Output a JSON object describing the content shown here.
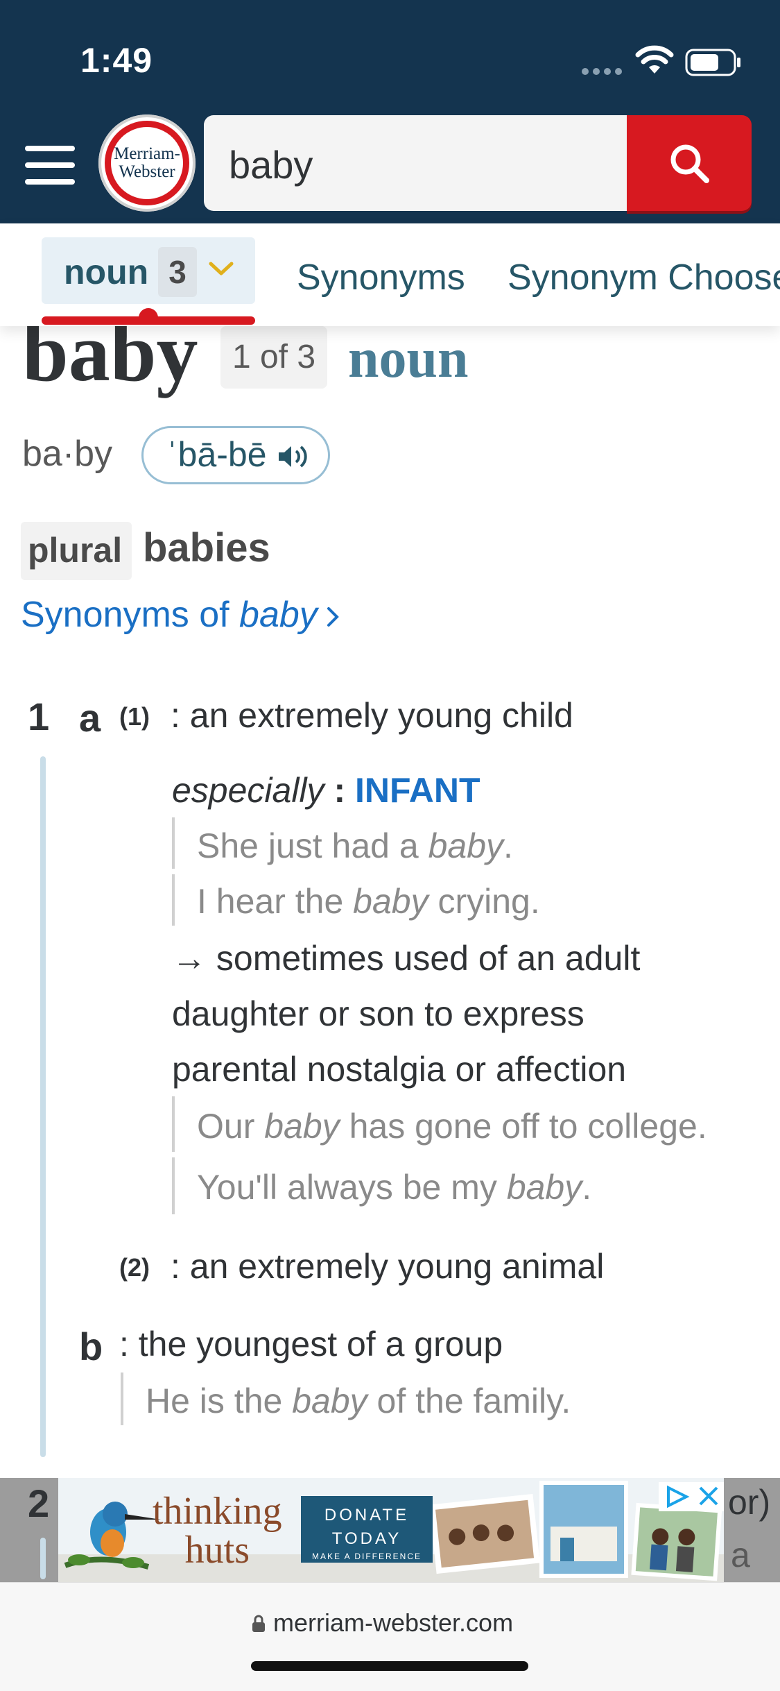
{
  "status_bar": {
    "time": "1:49"
  },
  "header": {
    "logo_line1": "Merriam-",
    "logo_line2": "Webster",
    "search_value": "baby"
  },
  "tabs": {
    "noun_label": "noun",
    "noun_count": "3",
    "synonyms": "Synonyms",
    "synonym_chooser": "Synonym Chooser"
  },
  "entry": {
    "headword": "baby",
    "index": "1 of 3",
    "pos": "noun",
    "syllables": "ba·by",
    "pronunciation": "ˈbā-bē",
    "plural_label": "plural",
    "plural_word": "babies",
    "synonyms_link_prefix": "Synonyms of ",
    "synonyms_link_word": "baby"
  },
  "definitions": {
    "sense1_num": "1",
    "sense1a_letter": "a",
    "sense1a1_sub": "(1)",
    "sense1a1_text": ": an extremely young child",
    "especially": "especially",
    "especially_colon": " : ",
    "especially_ref": "INFANT",
    "ex1_pre": "She just had a ",
    "ex1_word": "baby",
    "ex1_post": ".",
    "ex2_pre": "I hear the ",
    "ex2_word": "baby",
    "ex2_post": " crying.",
    "note_arrow": "→",
    "note_line1": " sometimes used of an adult",
    "note_line2": "daughter or son to express",
    "note_line3": "parental nostalgia or affection",
    "ex3_pre": "Our ",
    "ex3_word": "baby",
    "ex3_post": " has gone off to college.",
    "ex4_pre": "You'll always be my ",
    "ex4_word": "baby",
    "ex4_post": ".",
    "sense1a2_sub": "(2)",
    "sense1a2_text": ": an extremely young animal",
    "sense1b_letter": "b",
    "sense1b_text": ": the youngest of a group",
    "ex5_pre": "He is the ",
    "ex5_word": "baby",
    "ex5_post": " of the family.",
    "sense2_num": "2",
    "sense2_trail1": "or)",
    "sense2_trail2": "a"
  },
  "ad": {
    "brand_line1": "thinking",
    "brand_line2": "huts",
    "donate_line1": "DONATE",
    "donate_line2": "TODAY",
    "donate_line3": "MAKE A DIFFERENCE"
  },
  "url_bar": {
    "domain": "merriam-webster.com"
  }
}
